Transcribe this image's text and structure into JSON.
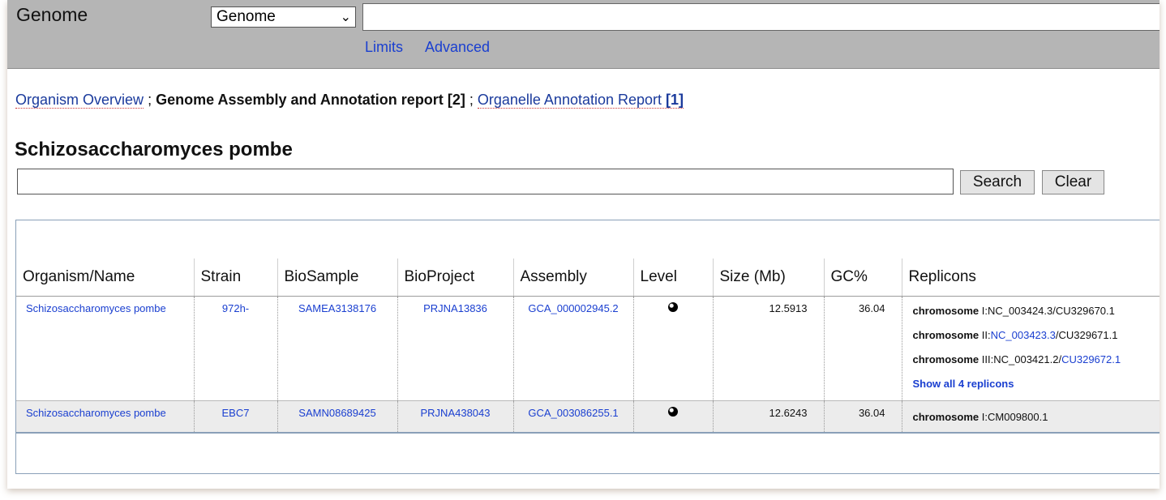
{
  "header": {
    "db_title": "Genome",
    "db_select_value": "Genome",
    "search_value": "",
    "links": {
      "limits": "Limits",
      "advanced": "Advanced"
    }
  },
  "tabs": {
    "overview": "Organism Overview",
    "sep1": ";",
    "assembly_report": "Genome Assembly and Annotation report",
    "assembly_count": "[2]",
    "sep2": ";",
    "organelle": "Organelle Annotation Report",
    "organelle_count": "[1]"
  },
  "organism_title": "Schizosaccharomyces pombe",
  "filter": {
    "value": "",
    "search_label": "Search",
    "clear_label": "Clear"
  },
  "table": {
    "columns": [
      "Organism/Name",
      "Strain",
      "BioSample",
      "BioProject",
      "Assembly",
      "Level",
      "Size (Mb)",
      "GC%",
      "Replicons"
    ],
    "rows": [
      {
        "organism": "Schizosaccharomyces pombe",
        "strain": "972h-",
        "biosample": "SAMEA3138176",
        "bioproject": "PRJNA13836",
        "assembly": "GCA_000002945.2",
        "level_icon": "complete-genome-icon",
        "size": "12.5913",
        "gc": "36.04",
        "replicons": [
          {
            "kind": "chromosome",
            "name": "I",
            "refseq": "NC_003424.3",
            "genbank": "CU329670.1"
          },
          {
            "kind": "chromosome",
            "name": "II",
            "refseq": "NC_003423.3",
            "genbank": "CU329671.1"
          },
          {
            "kind": "chromosome",
            "name": "III",
            "refseq": "NC_003421.2",
            "genbank": "CU329672.1"
          }
        ],
        "show_all": "Show all 4 replicons"
      },
      {
        "organism": "Schizosaccharomyces pombe",
        "strain": "EBC7",
        "biosample": "SAMN08689425",
        "bioproject": "PRJNA438043",
        "assembly": "GCA_003086255.1",
        "level_icon": "complete-genome-icon",
        "size": "12.6243",
        "gc": "36.04",
        "replicons": [
          {
            "kind": "chromosome",
            "name": "I",
            "genbank": "CM009800.1"
          }
        ]
      }
    ]
  }
}
